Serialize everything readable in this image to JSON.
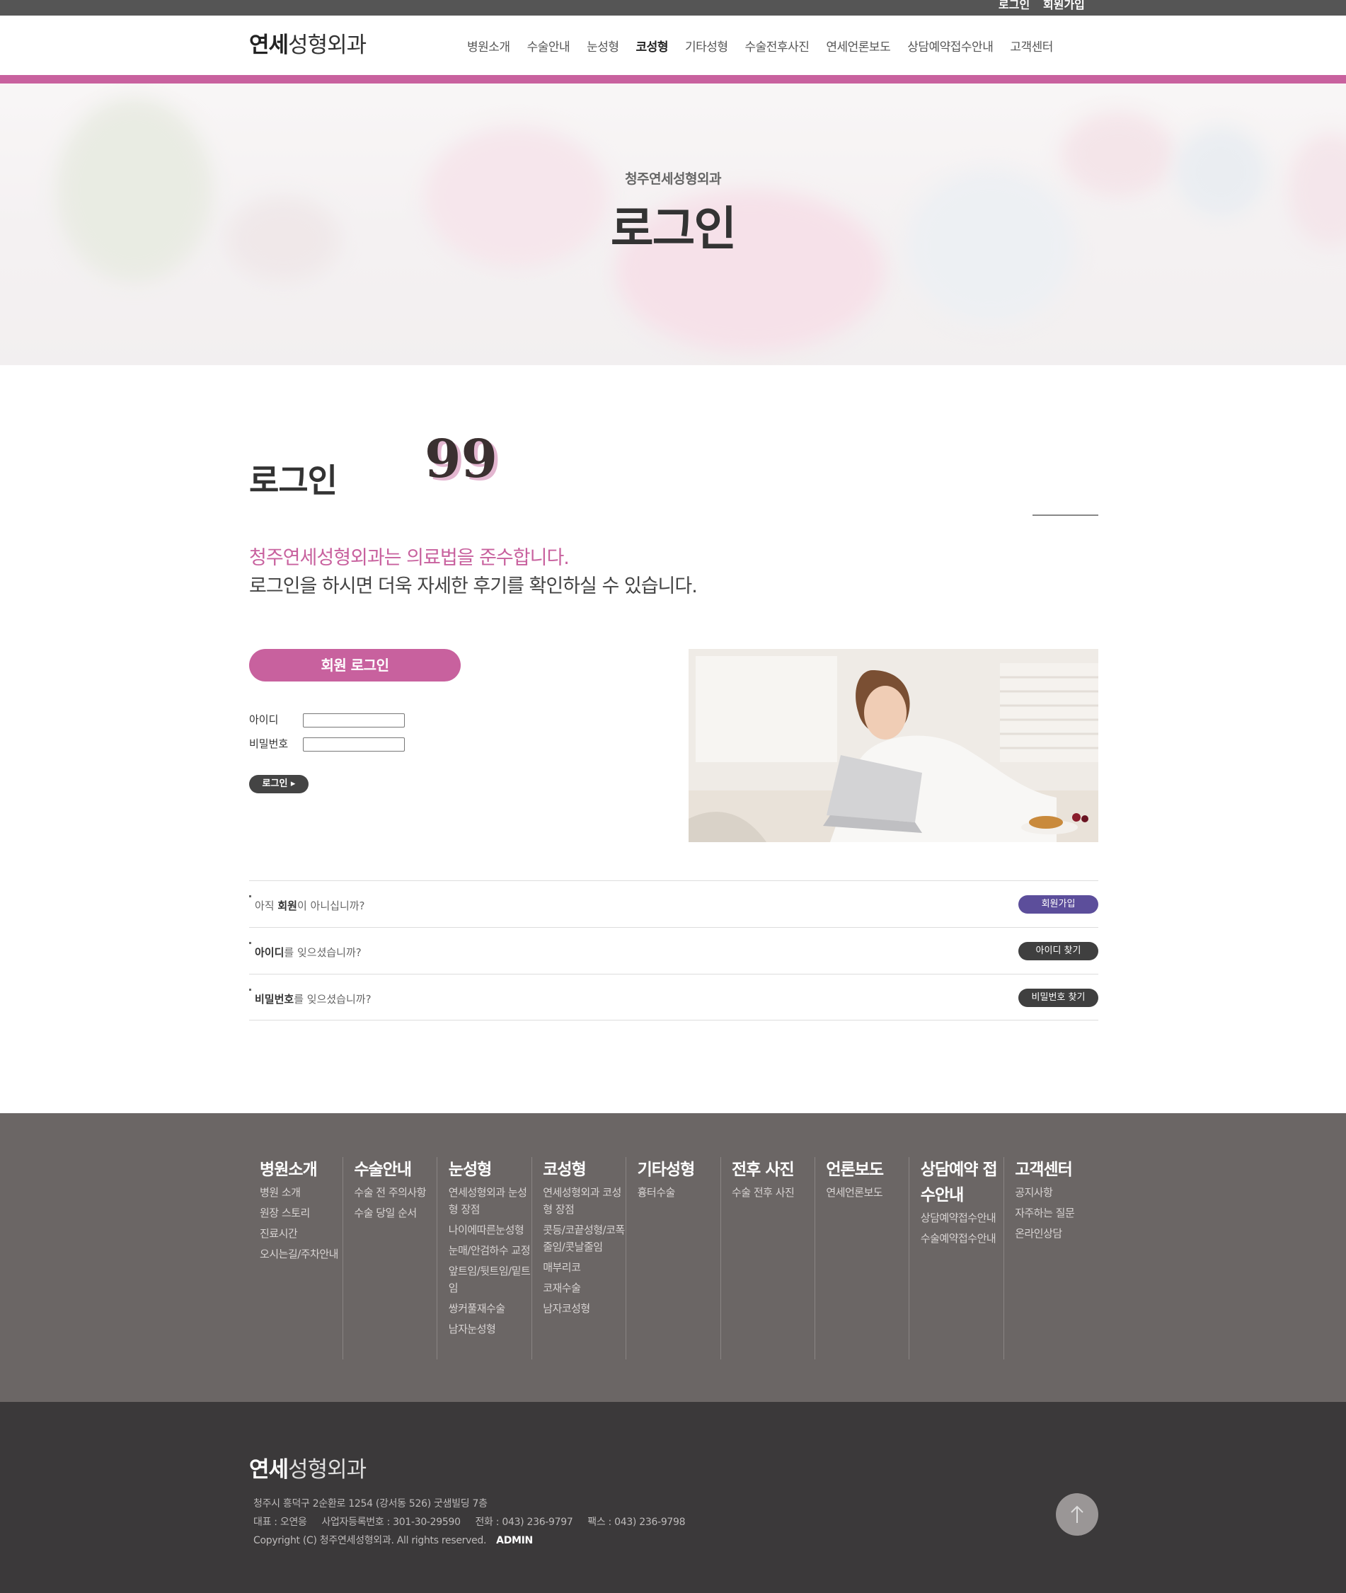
{
  "topbar": {
    "login": "로그인",
    "join": "회원가입"
  },
  "header": {
    "logo_bold": "연세",
    "logo_rest": "성형외과",
    "nav": [
      "병원소개",
      "수술안내",
      "눈성형",
      "코성형",
      "기타성형",
      "수술전후사진",
      "연세언론보도",
      "상담예약접수안내",
      "고객센터"
    ],
    "active_nav": "코성형",
    "accent_color": "#c8619e"
  },
  "hero": {
    "subtitle": "청주연세성형외과",
    "title": "로그인"
  },
  "login": {
    "section_title": "로그인",
    "quote_mark": "99",
    "notice_line1": "청주연세성형외과는 의료법을 준수합니다.",
    "notice_line2": "로그인을 하시면 더욱 자세한 후기를 확인하실 수 있습니다.",
    "member_login_label": "회원 로그인",
    "id_label": "아이디",
    "password_label": "비밀번호",
    "id_value": "",
    "password_value": "",
    "submit_label": "로그인 ▸"
  },
  "help_rows": [
    {
      "pre": "아직 ",
      "bold": "회원",
      "post": "이 아니십니까?",
      "button": "회원가입",
      "button_color": "#5c4e9b"
    },
    {
      "pre": "",
      "bold": "아이디",
      "post": "를 잊으셨습니까?",
      "button": "아이디 찾기",
      "button_color": "#3f3f3f"
    },
    {
      "pre": "",
      "bold": "비밀번호",
      "post": "를 잊으셨습니까?",
      "button": "비밀번호 찾기",
      "button_color": "#3f3f3f"
    }
  ],
  "sitemap": [
    {
      "title": "병원소개",
      "items": [
        "병원 소개",
        "원장 스토리",
        "진료시간",
        "오시는길/주차안내"
      ]
    },
    {
      "title": "수술안내",
      "items": [
        "수술 전 주의사항",
        "수술 당일 순서"
      ]
    },
    {
      "title": "눈성형",
      "items": [
        "연세성형외과 눈성형 장점",
        "나이에따른눈성형",
        "눈매/안검하수 교정",
        "앞트임/뒷트임/밑트임",
        "쌍커풀재수술",
        "남자눈성형"
      ]
    },
    {
      "title": "코성형",
      "items": [
        "연세성형외과 코성형 장점",
        "콧등/코끝성형/코폭줄임/콧날줄임",
        "매부리코",
        "코재수술",
        "남자코성형"
      ]
    },
    {
      "title": "기타성형",
      "items": [
        "흉터수술"
      ]
    },
    {
      "title": "전후 사진",
      "items": [
        "수술 전후 사진"
      ]
    },
    {
      "title": "언론보도",
      "items": [
        "연세언론보도"
      ]
    },
    {
      "title": "상담예약 접수안내",
      "items": [
        "상담예약접수안내",
        "수술예약접수안내"
      ]
    },
    {
      "title": "고객센터",
      "items": [
        "공지사항",
        "자주하는 질문",
        "온라인상담"
      ]
    }
  ],
  "footer": {
    "logo_bold": "연세",
    "logo_rest": "성형외과",
    "address": "청주시 흥덕구 2순환로 1254 (강서동 526) 굿샘빌딩 7층",
    "company": "대표 : 오연응     사업자등록번호 : 301-30-29590     전화 : 043) 236-9797     팩스 : 043) 236-9798",
    "copyright": "Copyright (C) 청주연세성형외과. All rights reserved.",
    "admin": "ADMIN",
    "top_icon": "arrow-up-icon"
  }
}
